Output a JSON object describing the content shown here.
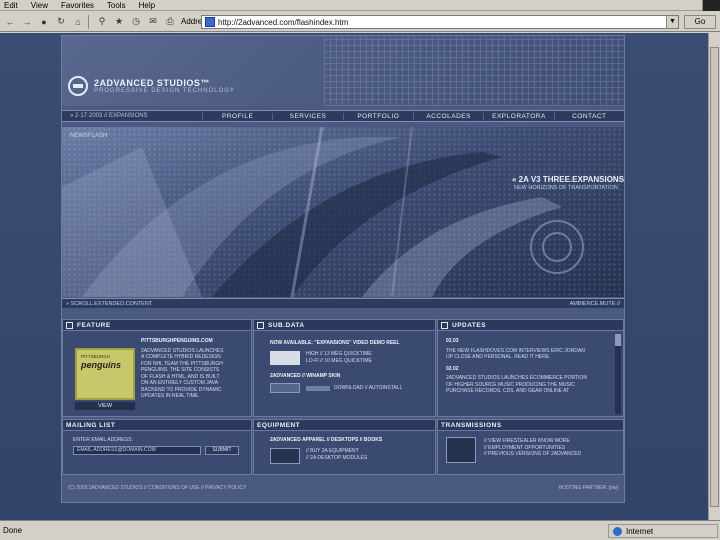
{
  "browser": {
    "menu": [
      "Edit",
      "View",
      "Favorites",
      "Tools",
      "Help"
    ],
    "address_label": "Address",
    "url": "http://2advanced.com/flashindex.htm",
    "go_label": "Go",
    "status_left": "Done",
    "status_zone": "Internet"
  },
  "site": {
    "logo_title": "2ADVANCED STUDIOS™",
    "logo_tagline": "PROGRESSIVE DESIGN TECHNOLOGY",
    "nav_date": "» 2·17·2003 // EXPANSIONS",
    "nav": [
      "PROFILE",
      "SERVICES",
      "PORTFOLIO",
      "ACCOLADES",
      "EXPLORATORA",
      "CONTACT"
    ],
    "hero": {
      "label": "NEWSFLASH",
      "headline": "« 2A V3 THREE.EXPANSIONS",
      "sub": "NEW HORIZONS OF TRANSPORTATION",
      "scroll_left": "» SCROLL.EXTENDED.CONTENT",
      "scroll_right": "AMBIENCE.MUTE //"
    },
    "feature": {
      "title": "FEATURE",
      "img_top": "PITTSBURGH",
      "img_name": "penguins",
      "view": "VIEW",
      "heading": "PITTSBURGHPENGUINS.COM",
      "body": [
        "2ADVANCED STUDIOS LAUNCHES",
        "A COMPLETE HYBRID REDESIGN",
        "FOR NHL TEAM THE PITTSBURGH",
        "PENGUINS. THE SITE CONSISTS",
        "OF FLASH & HTML, AND IS BUILT",
        "ON AN ENTIRELY CUSTOM JAVA",
        "BACKEND TO PROVIDE DYNAMIC",
        "UPDATES IN REAL TIME."
      ]
    },
    "subdata": {
      "title": "SUB.DATA",
      "reel_heading": "NOW AVAILABLE: \"EXPANSIONS\" VIDEO DEMO REEL",
      "reel_links": [
        "HIGH // 13 MEG QUICKTIME",
        "LO-FI // 10 MEG QUICKTIME"
      ],
      "skin_heading": "2ADVANCED // WINAMP SKIN",
      "skin_link": "DOWNLOAD // AUTOINSTALL"
    },
    "updates": {
      "title": "UPDATES",
      "items": [
        {
          "date": "02.03",
          "lines": [
            "THE NEW FLASHDOVES.COM INTERVIEWS ERIC JORDAN",
            "UP CLOSE AND PERSONAL. READ IT HERE."
          ]
        },
        {
          "date": "02.02",
          "lines": [
            "2ADVANCED STUDIOS LAUNCHES ECOMMERCE PORTION",
            "OF HIGHER SOURCE MUSIC PRODUCING THE MUSIC",
            "PURCHASE RECORDS, CDS, AND GEAR ONLINE AT"
          ]
        }
      ]
    },
    "mailing": {
      "title": "MAILING LIST",
      "label": "ENTER EMAIL ADDRESS:",
      "placeholder": "EMAIL.ADDRESS@DOMAIN.COM",
      "submit": "SUBMIT"
    },
    "equipment": {
      "title": "EQUIPMENT",
      "heading": "2ADVANCED APPAREL // DESKTOPS // BOOKS",
      "links": [
        "// BUY 2A EQUIPMENT",
        "// 2A DESKTOP MODULES"
      ]
    },
    "transmissions": {
      "title": "TRANSMISSIONS",
      "links": [
        "// VIEW FIRESTEALER KNOW MORE",
        "// EMPLOYMENT OPPORTUNITIES",
        "// PREVIOUS VERSIONS OF 2ADVANCED"
      ]
    },
    "footer_left": "(C) 2003 2ADVANCED STUDIOS // CONDITIONS OF USE // PRIVACY POLICY",
    "footer_right": "HOSTING PARTNER: [nw]"
  }
}
